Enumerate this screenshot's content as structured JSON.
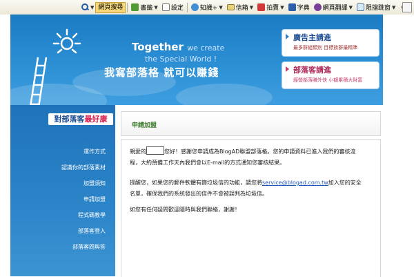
{
  "toolbar": {
    "search_label": "網頁搜尋",
    "items": [
      {
        "label": "書籤",
        "has_dropdown": true
      },
      {
        "label": "設定",
        "has_dropdown": true
      },
      {
        "label": "知識+",
        "has_dropdown": true
      },
      {
        "label": "信箱",
        "has_dropdown": true
      },
      {
        "label": "拍賣",
        "has_dropdown": true
      },
      {
        "label": "字典",
        "has_dropdown": false
      },
      {
        "label": "網頁翻譯",
        "has_dropdown": true
      },
      {
        "label": "阻擋跳窗",
        "has_dropdown": true
      }
    ]
  },
  "banner": {
    "slogan_en_1_bold": "Together",
    "slogan_en_1_light": "we create",
    "slogan_en_2": "the Special World !",
    "slogan_zh": "我寫部落格 就可以賺錢",
    "advertiser_cta": {
      "title": "廣告主請進",
      "subtitle": "最多群組類別 目標族群最精準"
    },
    "blogger_cta": {
      "title": "部落客請進",
      "subtitle": "經營部落賺外快 小額累積大財富"
    }
  },
  "sidebar": {
    "badge_part1": "對部落客",
    "badge_part2": "最好康",
    "menu": [
      "運作方式",
      "認識你的部落素材",
      "加盟須知",
      "申請加盟",
      "程式碼教學",
      "部落客登入",
      "部落客問與答"
    ]
  },
  "content": {
    "panel_title": "申請加盟",
    "p1_before": "親愛的",
    "p1_after": "您好！感謝您申請成為BlogAD聯盟部落格。您的申請資料已進入我們的審核流程，大約預備工作天內我們會以E-mail的方式通知您審核結果。",
    "p2_before": "提醒您，如果您的郵件軟體有篩垃圾信的功能，請您將",
    "p2_email": "service@blogad.com.tw",
    "p2_after": "加入您的安全名單，確保我們的系統發出的信件不會被誤判為垃圾信。",
    "p3": "如您有任何疑問歡迎隨時與我們聯絡，謝謝！"
  },
  "colors": {
    "banner_blue": "#2c8fd4",
    "sidebar_blue": "#2c85c9",
    "panel_title_green": "#3c7a2c",
    "link_blue": "#2155b8",
    "badge_pink": "#d41f4b"
  }
}
